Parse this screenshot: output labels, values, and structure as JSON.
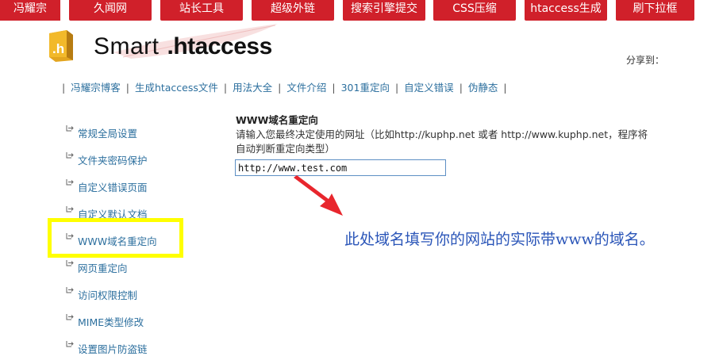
{
  "topnav": {
    "tabs": [
      {
        "label": "冯耀宗"
      },
      {
        "label": "久闻网"
      },
      {
        "label": "站长工具"
      },
      {
        "label": "超级外链"
      },
      {
        "label": "搜索引擎提交"
      },
      {
        "label": "CSS压缩"
      },
      {
        "label": "htaccess生成"
      },
      {
        "label": "刷下拉框"
      }
    ],
    "color": "#d0202a"
  },
  "logo": {
    "icon_text": ".h",
    "icon": "htaccess-logo-icon",
    "word1": "Smart",
    "word2": ".htaccess"
  },
  "share": {
    "label": "分享到："
  },
  "subnav": {
    "items": [
      {
        "label": "冯耀宗博客"
      },
      {
        "label": "生成htaccess文件"
      },
      {
        "label": "用法大全"
      },
      {
        "label": "文件介绍"
      },
      {
        "label": "301重定向"
      },
      {
        "label": "自定义错误"
      },
      {
        "label": "伪静态"
      }
    ],
    "separator": "|"
  },
  "sidebar": {
    "items": [
      {
        "label": "常规全局设置"
      },
      {
        "label": "文件夹密码保护"
      },
      {
        "label": "自定义错误页面"
      },
      {
        "label": "自定义默认文档"
      },
      {
        "label": "WWW域名重定向"
      },
      {
        "label": "网页重定向"
      },
      {
        "label": "访问权限控制"
      },
      {
        "label": "MIME类型修改"
      },
      {
        "label": "设置图片防盗链"
      }
    ],
    "highlight_color": "#ffff00"
  },
  "main": {
    "title": "WWW域名重定向",
    "description": "请输入您最终决定使用的网址（比如http://kuphp.net 或者 http://www.kuphp.net，程序将自动判断重定向类型）",
    "input_value": "http://www.test.com",
    "annotation": "此处域名填写你的网站的实际带www的域名。",
    "annotation_color": "#2a55b8",
    "arrow_color": "#e8262d"
  }
}
